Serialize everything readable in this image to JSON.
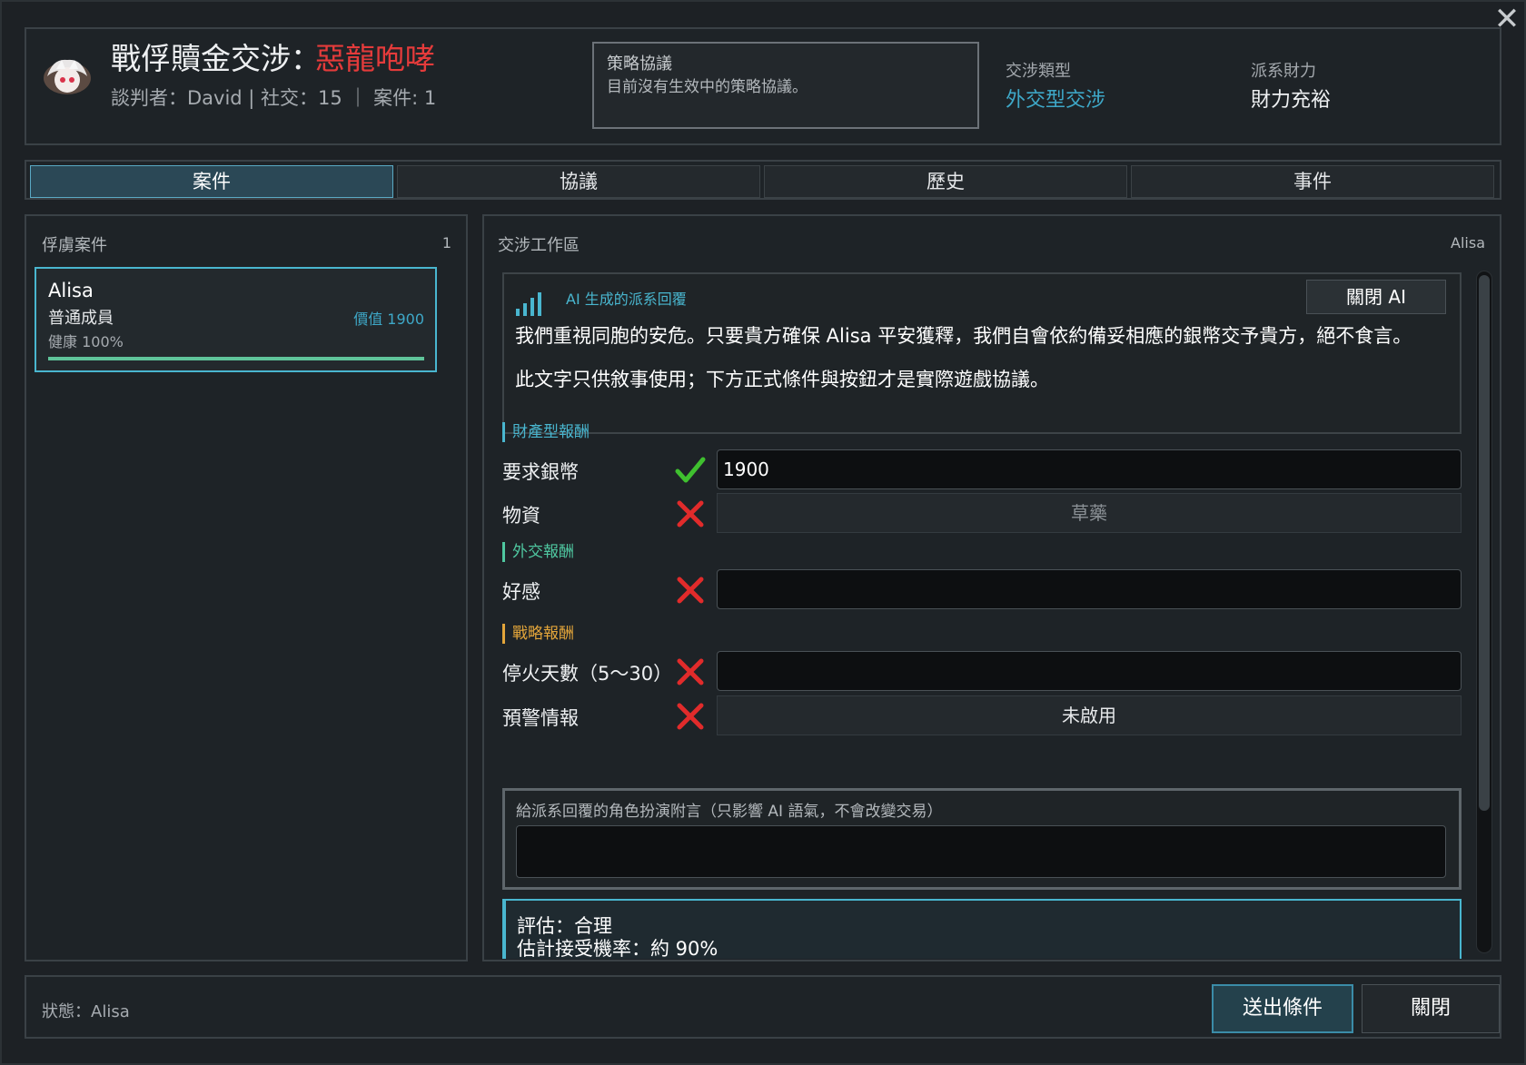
{
  "header": {
    "title_prefix": "戰俘贖金交涉：",
    "faction_name": "惡龍咆哮",
    "sub_info": "談判者：David | 社交：15 ｜ 案件: 1",
    "strategy": {
      "label": "策略協議",
      "text": "目前沒有生效中的策略協議。"
    },
    "negotiation_type": {
      "label": "交涉類型",
      "value": "外交型交涉"
    },
    "faction_wealth": {
      "label": "派系財力",
      "value": "財力充裕"
    }
  },
  "tabs": [
    {
      "label": "案件",
      "active": true
    },
    {
      "label": "協議",
      "active": false
    },
    {
      "label": "歷史",
      "active": false
    },
    {
      "label": "事件",
      "active": false
    }
  ],
  "left": {
    "title": "俘虜案件",
    "count": "1",
    "case": {
      "name": "Alisa",
      "rank": "普通成員",
      "value": "價值 1900",
      "health": "健康 100%",
      "health_fraction": 1.0
    }
  },
  "workspace": {
    "title": "交涉工作區",
    "captive": "Alisa",
    "ai": {
      "label": "AI 生成的派系回覆",
      "close_button": "關閉 AI",
      "text1": "我們重視同胞的安危。只要貴方確保 Alisa 平安獲釋，我們自會依約備妥相應的銀幣交予貴方，絕不食言。",
      "text2": "此文字只供敘事使用；下方正式條件與按鈕才是實際遊戲協議。"
    },
    "sections": {
      "property": "財產型報酬",
      "diplomatic": "外交報酬",
      "strategic": "戰略報酬"
    },
    "rows": {
      "silver": {
        "label": "要求銀幣",
        "value": "1900",
        "status": "check"
      },
      "goods": {
        "label": "物資",
        "value": "草藥",
        "status": "cross"
      },
      "goodwill": {
        "label": "好感",
        "value": "",
        "status": "cross"
      },
      "ceasefire": {
        "label": "停火天數（5～30）",
        "value": "",
        "status": "cross"
      },
      "intel": {
        "label": "預警情報",
        "value": "未啟用",
        "status": "cross"
      }
    },
    "note": {
      "label": "給派系回覆的角色扮演附言（只影響 AI 語氣，不會改變交易）",
      "value": ""
    },
    "evaluation": {
      "line1": "評估：合理",
      "line2": "估計接受機率：約 90%"
    }
  },
  "footer": {
    "status": "狀態：Alisa",
    "send_button": "送出條件",
    "close_button": "關閉"
  },
  "colors": {
    "accent": "#49b6cf",
    "faction_red": "#e43b3b",
    "check_green": "#3fc02f",
    "cross_red": "#e12b2b",
    "section_property": "#49b6cf",
    "section_diplomatic": "#4fc7a0",
    "section_strategic": "#e3a53a"
  }
}
